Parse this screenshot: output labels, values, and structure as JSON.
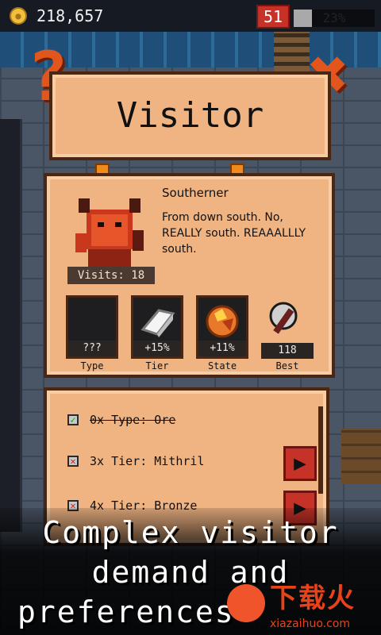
{
  "hud": {
    "gold": "218,657",
    "level": "51",
    "xp_percent": "23%",
    "xp_fraction": 0.23
  },
  "title": "Visitor",
  "visitor": {
    "name": "Southerner",
    "description": "From down south. No, REALLY south. REAAALLLY south.",
    "visits": "Visits: 18",
    "stats": [
      {
        "label": "Type",
        "value": "???",
        "icon": "unknown-icon"
      },
      {
        "label": "Tier",
        "value": "+15%",
        "icon": "ingot-icon"
      },
      {
        "label": "State",
        "value": "+11%",
        "icon": "gem-icon"
      },
      {
        "label": "Best",
        "value": "118",
        "icon": "axe-icon"
      }
    ]
  },
  "demands": [
    {
      "text": "0x Type: Ore",
      "done": true,
      "has_button": false
    },
    {
      "text": "3x Tier: Mithril",
      "done": false,
      "has_button": true
    },
    {
      "text": "4x Tier: Bronze",
      "done": false,
      "has_button": true
    }
  ],
  "caption": [
    "Complex visitor",
    "demand and",
    "preferences"
  ],
  "watermark": {
    "title": "下载火",
    "url": "xiazaihuo.com"
  },
  "colors": {
    "panel": "#f0b483",
    "panel_border": "#4b2613",
    "accent_red": "#c63128",
    "icon_orange": "#e2561d"
  }
}
